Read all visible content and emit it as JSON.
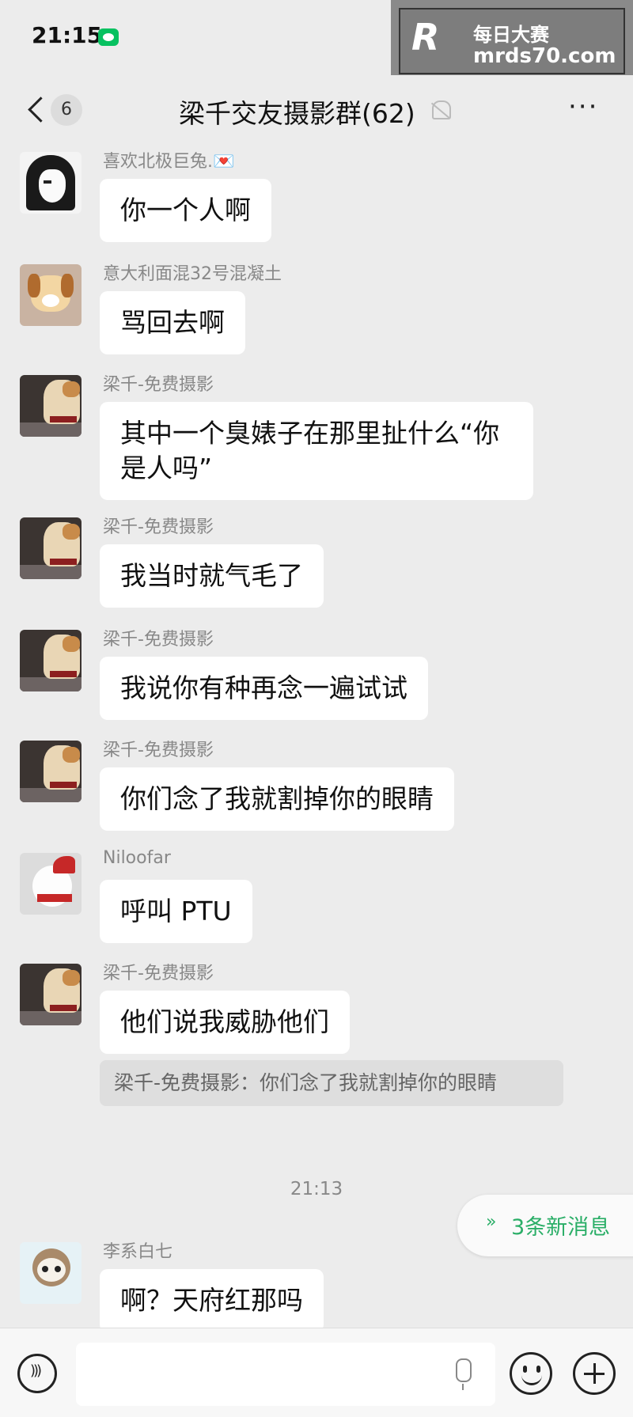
{
  "status_bar": {
    "time": "21:15"
  },
  "watermark": {
    "logo": "R",
    "brand_cn": "每日大赛",
    "site": "mrds70.com"
  },
  "nav": {
    "unread_count": "6",
    "title": "梁千交友摄影群(62)",
    "more": "···"
  },
  "messages": [
    {
      "sender": "喜欢北极巨兔.💌",
      "text": "你一个人啊",
      "avatar": "girl-avatar"
    },
    {
      "sender": "意大利面混32号混凝土",
      "text": "骂回去啊",
      "avatar": "dog-avatar"
    },
    {
      "sender": "梁千-免费摄影",
      "text": "其中一个臭婊子在那里扯什么“你是人吗”",
      "avatar": "corgi-avatar"
    },
    {
      "sender": "梁千-免费摄影",
      "text": "我当时就气毛了",
      "avatar": "corgi-avatar"
    },
    {
      "sender": "梁千-免费摄影",
      "text": "我说你有种再念一遍试试",
      "avatar": "corgi-avatar"
    },
    {
      "sender": "梁千-免费摄影",
      "text": "你们念了我就割掉你的眼睛",
      "avatar": "corgi-avatar"
    },
    {
      "sender": "Niloofar",
      "text": "呼叫 PTU",
      "avatar": "santa-dog-avatar"
    },
    {
      "sender": "梁千-免费摄影",
      "text": "他们说我威胁他们",
      "avatar": "corgi-avatar"
    },
    {
      "sender": "李系白七",
      "text": "啊？天府红那吗",
      "avatar": "cartoon-avatar"
    }
  ],
  "quote": {
    "text": "梁千-免费摄影：你们念了我就割掉你的眼睛"
  },
  "timestamp": "21:13",
  "new_messages": {
    "icon": "double-chevron-down-icon",
    "label": "3条新消息"
  },
  "input_bar": {
    "placeholder": ""
  },
  "colors": {
    "background": "#ececec",
    "bubble": "#ffffff",
    "accent_green": "#2aae67"
  }
}
